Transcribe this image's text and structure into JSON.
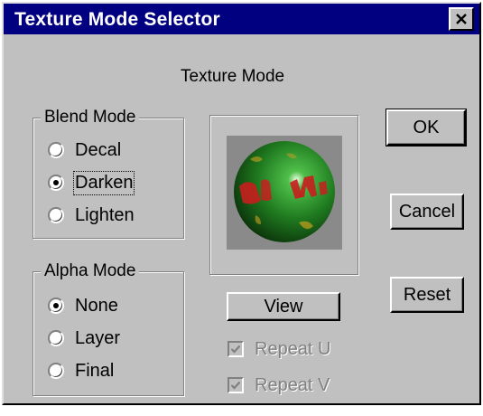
{
  "window": {
    "title": "Texture Mode Selector",
    "close_icon": "close-icon"
  },
  "heading": "Texture Mode",
  "blend_mode": {
    "label": "Blend Mode",
    "options": [
      "Decal",
      "Darken",
      "Lighten"
    ],
    "selected": "Darken"
  },
  "alpha_mode": {
    "label": "Alpha Mode",
    "options": [
      "None",
      "Layer",
      "Final"
    ],
    "selected": "None"
  },
  "buttons": {
    "ok": "OK",
    "cancel": "Cancel",
    "reset": "Reset",
    "view": "View"
  },
  "repeat": {
    "u": "Repeat U",
    "v": "Repeat V",
    "u_checked": true,
    "v_checked": true,
    "enabled": false
  },
  "colors": {
    "title_bar": "#000080",
    "dialog_face": "#c0c0c0",
    "sphere": "#1f7a1f",
    "sphere_text": "#c81e1e",
    "preview_bg": "#8a8a8a"
  }
}
